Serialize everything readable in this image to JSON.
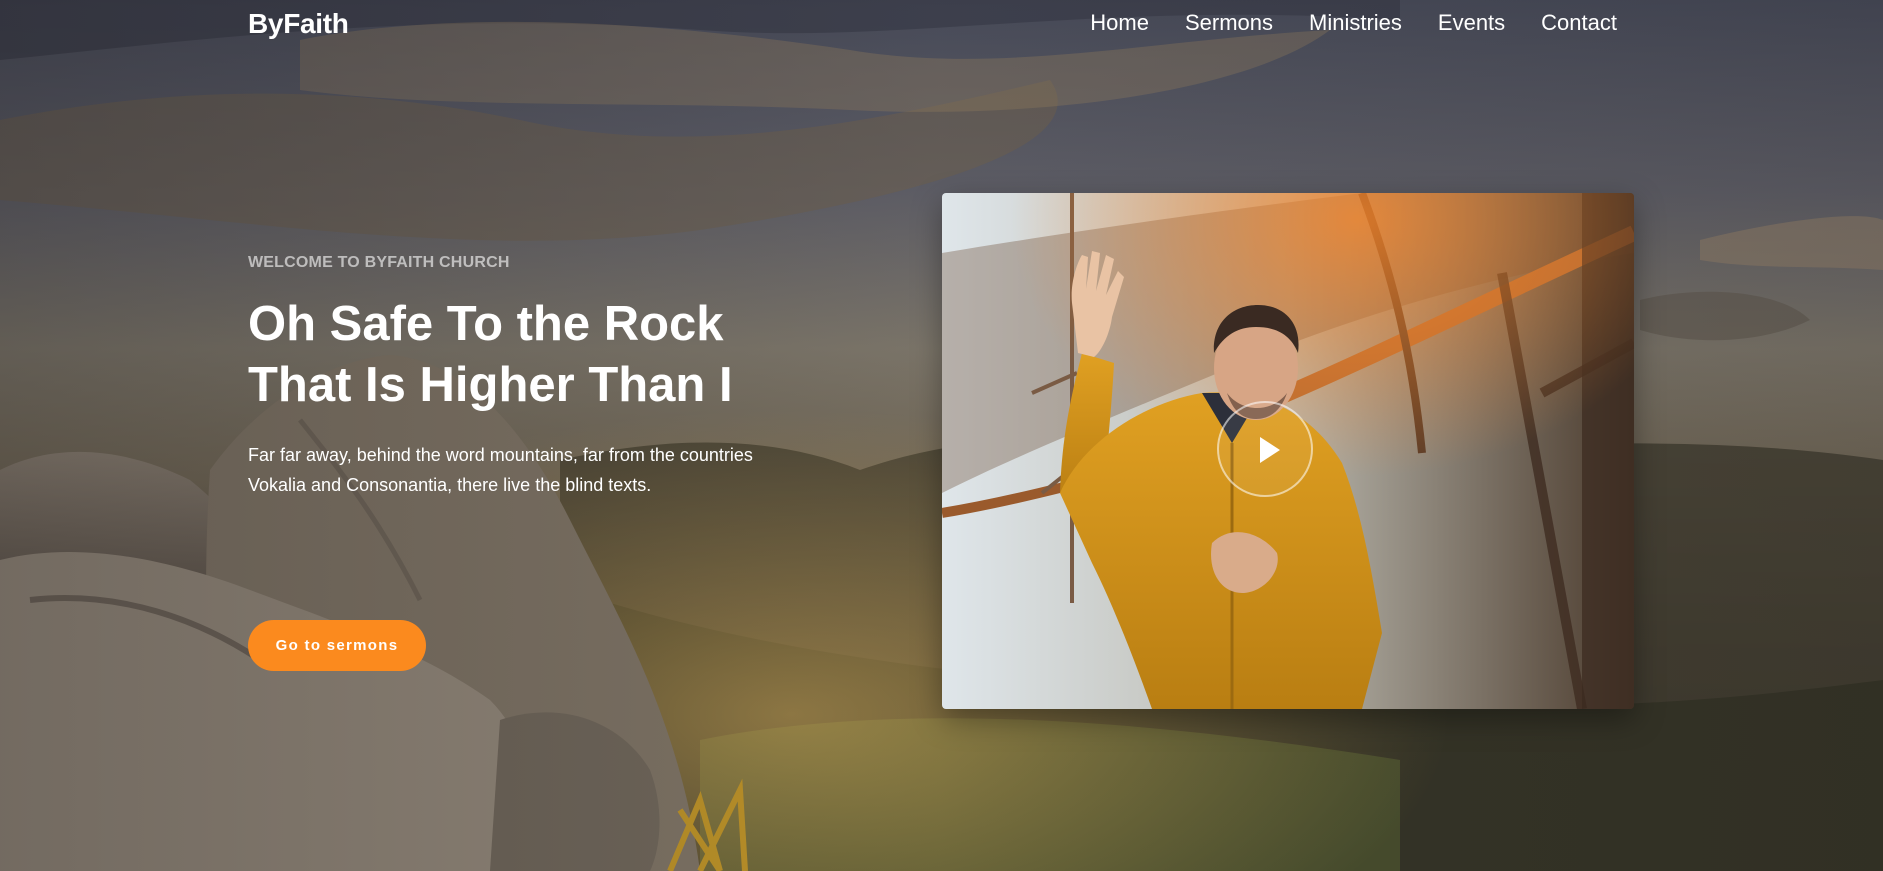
{
  "brand": "ByFaith",
  "nav": {
    "items": [
      {
        "label": "Home"
      },
      {
        "label": "Sermons"
      },
      {
        "label": "Ministries"
      },
      {
        "label": "Events"
      },
      {
        "label": "Contact"
      }
    ]
  },
  "hero": {
    "eyebrow": "Welcome to ByFaith Church",
    "headline": "Oh Safe To the Rock That Is Higher Than I",
    "lead": "Far far away, behind the word mountains, far from the countries Vokalia and Consonantia, there live the blind texts.",
    "cta_label": "Go to sermons"
  },
  "video": {
    "play_icon": "play-icon"
  },
  "colors": {
    "accent": "#fb8a1e",
    "text": "#ffffff"
  }
}
